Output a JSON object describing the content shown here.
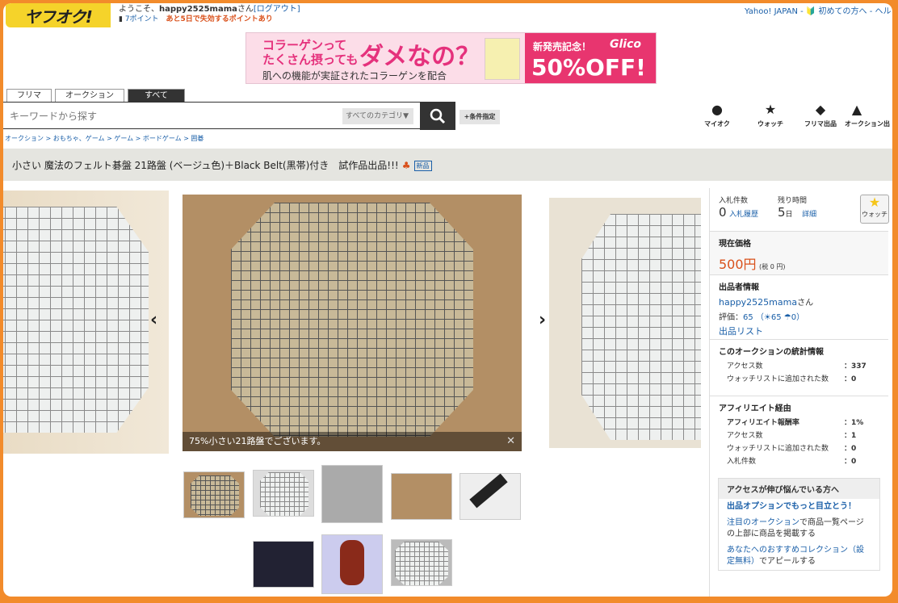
{
  "header": {
    "logo": "ヤフオク!",
    "welcome_prefix": "ようこそ、",
    "username": "happy2525mama",
    "welcome_suffix": "さん",
    "logout": "[ログアウト]",
    "points": "7ポイント",
    "campaign": "あと5日で失効するポイントあり",
    "toplinks": "Yahoo! JAPAN - 🔰 初めての方へ - ヘル"
  },
  "banner": {
    "line1": "コラーゲンって",
    "line2": "たくさん摂っても",
    "big": "ダメなの？",
    "line3": "肌への機能が実証されたコラーゲンを配合",
    "new": "新発売記念！",
    "brand": "Glico",
    "off": "50%OFF!"
  },
  "tabs": [
    {
      "label": "フリマ"
    },
    {
      "label": "オークション"
    },
    {
      "label": "すべて"
    }
  ],
  "search": {
    "placeholder": "キーワードから探す",
    "category": "すべてのカテゴリ",
    "advanced": "+条件指定"
  },
  "nav": [
    {
      "label": "マイオク",
      "icon": "person-icon"
    },
    {
      "label": "ウォッチ",
      "icon": "star-icon"
    },
    {
      "label": "フリマ出品",
      "icon": "tag-icon"
    },
    {
      "label": "オークション出",
      "icon": "gavel-icon"
    }
  ],
  "breadcrumb": "オークション > おもちゃ、ゲーム > ゲーム > ボードゲーム > 囲碁",
  "item": {
    "title": "小さい 魔法のフェルト碁盤 21路盤 (ベージュ色)＋Black Belt(黒帯)付き　試作品出品!!!",
    "new_badge": "新品",
    "caption": "75%小さい21路盤でございます。"
  },
  "right": {
    "bids_label": "入札件数",
    "bids_value": "0",
    "bids_link": "入札履歴",
    "time_label": "残り時間",
    "time_value": "5",
    "time_unit": "日",
    "time_link": "詳細",
    "watch": "ウォッチ",
    "price_label": "現在価格",
    "price": "500円",
    "tax": "(税 0 円)",
    "seller_label": "出品者情報",
    "seller": "happy2525mama",
    "seller_suffix": "さん",
    "rating_label": "評価：",
    "rating": "65",
    "rating_detail": "（☀65 ☂0）",
    "list_link": "出品リスト",
    "stats_title": "このオークションの統計情報",
    "stats": [
      {
        "label": "アクセス数",
        "value": "：337"
      },
      {
        "label": "ウォッチリストに追加された数",
        "value": "：0"
      }
    ],
    "aff_title": "アフィリエイト経由",
    "aff": [
      {
        "label": "アフィリエイト報酬率",
        "value": "：1%"
      },
      {
        "label": "アクセス数",
        "value": "：1"
      },
      {
        "label": "ウォッチリストに追加された数",
        "value": "：0"
      },
      {
        "label": "入札件数",
        "value": "：0"
      }
    ],
    "access_title": "アクセスが伸び悩んでいる方へ",
    "access_link": "出品オプションでもっと目立とう！",
    "access_p2a": "注目のオークション",
    "access_p2b": "で商品一覧ページの上部に商品を掲載する",
    "access_p3a": "あなたへのおすすめコレクション（設定無料）",
    "access_p3b": "でアピールする"
  },
  "colors": {
    "accent_orange": "#f28b2b",
    "link": "#1a5fa8",
    "price": "#d9501a",
    "logo": "#f5d32a"
  }
}
